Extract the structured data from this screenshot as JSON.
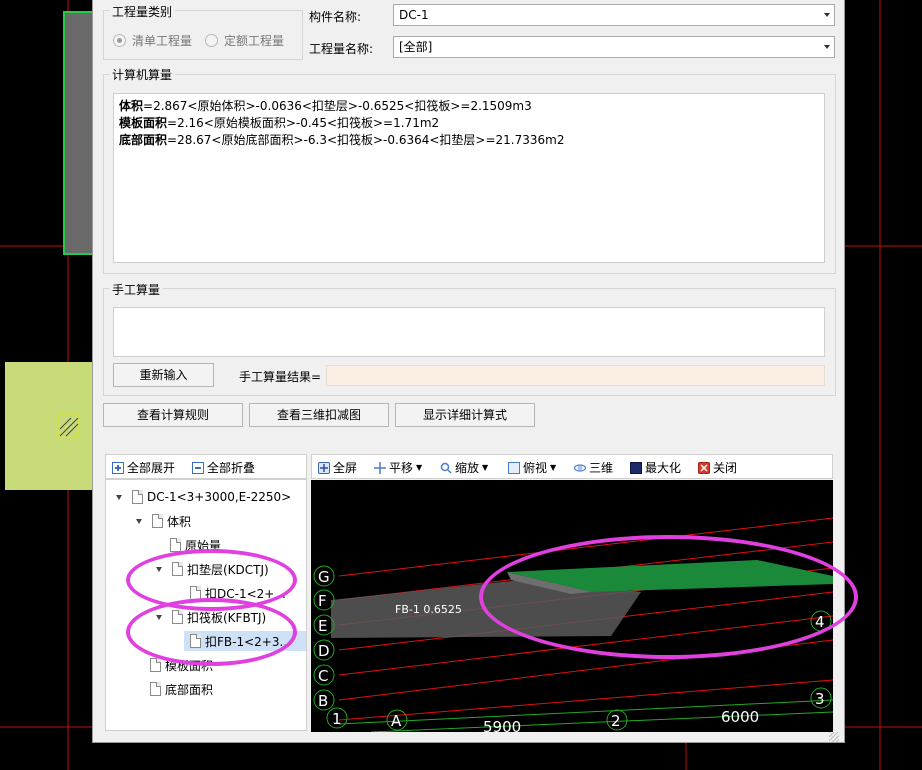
{
  "quantity_type": {
    "title": "工程量类别",
    "options": [
      {
        "label": "清单工程量",
        "selected": true
      },
      {
        "label": "定额工程量",
        "selected": false
      }
    ]
  },
  "component": {
    "name_label": "构件名称:",
    "name_value": "DC-1",
    "qty_name_label": "工程量名称:",
    "qty_name_value": "[全部]"
  },
  "computer_calc": {
    "title": "计算机算量",
    "lines": [
      {
        "name": "体积",
        "expr": "=2.867<原始体积>-0.0636<扣垫层>-0.6525<扣筏板>=2.1509m3"
      },
      {
        "name": "模板面积",
        "expr": "=2.16<原始模板面积>-0.45<扣筏板>=1.71m2"
      },
      {
        "name": "底部面积",
        "expr": "=28.67<原始底部面积>-6.3<扣筏板>-0.6364<扣垫层>=21.7336m2"
      }
    ]
  },
  "manual_calc": {
    "title": "手工算量",
    "reenter_label": "重新输入",
    "result_label": "手工算量结果=",
    "result_value": ""
  },
  "actions": {
    "view_rules": "查看计算规则",
    "view_3d_deduct": "查看三维扣减图",
    "show_detail": "显示详细计算式"
  },
  "tree_toolbar": {
    "expand_all": "全部展开",
    "collapse_all": "全部折叠"
  },
  "tree": {
    "root": "DC-1<3+3000,E-2250>",
    "volume": "体积",
    "original": "原始量",
    "deduct_pad": "扣垫层(KDCTJ)",
    "deduct_pad_child": "扣DC-1<2+...",
    "deduct_raft": "扣筏板(KFBTJ)",
    "deduct_raft_child": "扣FB-1<2+3...",
    "formwork_area": "模板面积",
    "bottom_area": "底部面积"
  },
  "view_toolbar": {
    "fullscreen": "全屏",
    "pan": "平移",
    "zoom": "缩放",
    "top_view": "俯视",
    "three_d": "三维",
    "maximize": "最大化",
    "close": "关闭"
  },
  "scene": {
    "axis_letters": [
      "G",
      "F",
      "E",
      "D",
      "C",
      "B"
    ],
    "axis_numbers": [
      "1",
      "2",
      "3",
      "4"
    ],
    "axis_A": "A",
    "dim_1": "5900",
    "dim_2": "6000",
    "raft_label": "FB-1 0.6525"
  },
  "colors": {
    "highlight_ellipse": "#e040e0",
    "grid_red": "#e01010",
    "slab_green": "#1a8a3a"
  }
}
